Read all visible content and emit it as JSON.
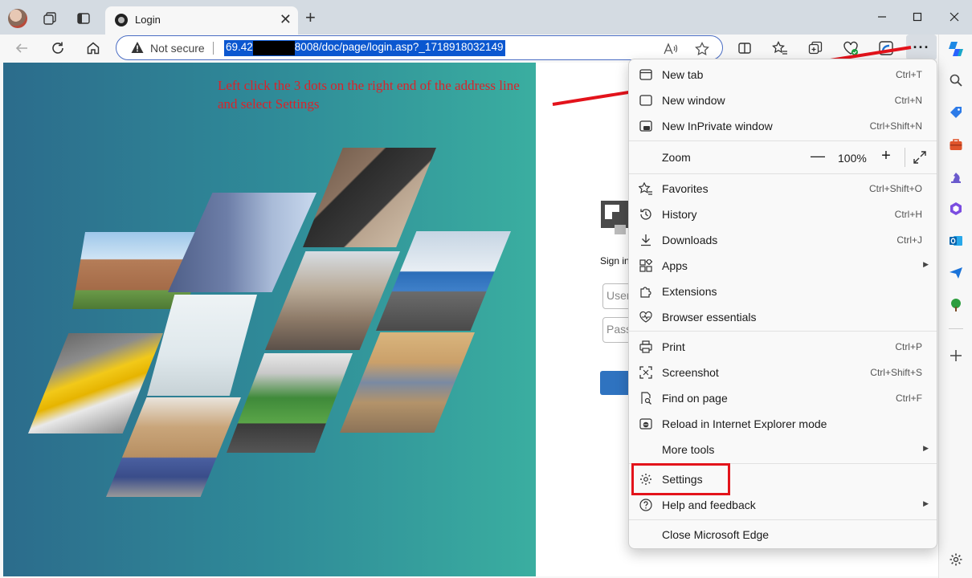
{
  "browser": {
    "tab_title": "Login",
    "close_glyph": "✕",
    "newtab_glyph": "+",
    "address": {
      "security_label": "Not secure",
      "url_prefix": "69.42",
      "url_suffix": "8008/doc/page/login.asp?_1718918032149"
    },
    "more_glyph": "···"
  },
  "page": {
    "instruction": "Left click the 3 dots on the right end of the address line and select Settings",
    "signin_text": "Sign in",
    "username_placeholder": "Username",
    "password_placeholder": "Password"
  },
  "menu": {
    "new_tab": {
      "label": "New tab",
      "shortcut": "Ctrl+T"
    },
    "new_window": {
      "label": "New window",
      "shortcut": "Ctrl+N"
    },
    "new_inprivate": {
      "label": "New InPrivate window",
      "shortcut": "Ctrl+Shift+N"
    },
    "zoom": {
      "label": "Zoom",
      "value": "100%",
      "minus": "—",
      "plus": "+"
    },
    "favorites": {
      "label": "Favorites",
      "shortcut": "Ctrl+Shift+O"
    },
    "history": {
      "label": "History",
      "shortcut": "Ctrl+H"
    },
    "downloads": {
      "label": "Downloads",
      "shortcut": "Ctrl+J"
    },
    "apps": {
      "label": "Apps"
    },
    "extensions": {
      "label": "Extensions"
    },
    "browser_essentials": {
      "label": "Browser essentials"
    },
    "print": {
      "label": "Print",
      "shortcut": "Ctrl+P"
    },
    "screenshot": {
      "label": "Screenshot",
      "shortcut": "Ctrl+Shift+S"
    },
    "find_on_page": {
      "label": "Find on page",
      "shortcut": "Ctrl+F"
    },
    "reload_ie": {
      "label": "Reload in Internet Explorer mode"
    },
    "more_tools": {
      "label": "More tools"
    },
    "settings": {
      "label": "Settings"
    },
    "help": {
      "label": "Help and feedback"
    },
    "close_edge": {
      "label": "Close Microsoft Edge"
    },
    "submenu_arrow": "▶"
  },
  "colors": {
    "annotation": "#e3131b",
    "url_highlight": "#0b57d0",
    "hero_start": "#2c6c8c",
    "hero_end": "#3aaea0"
  },
  "icons": [
    "profile-avatar",
    "workspaces-icon",
    "tab-actions-icon",
    "back-icon",
    "refresh-icon",
    "home-icon",
    "warning-icon",
    "read-aloud-icon",
    "favorite-star-icon",
    "split-screen-icon",
    "favorites-icon",
    "collections-icon",
    "performance-icon",
    "extension-icon",
    "more-icon",
    "copilot-icon",
    "search-icon",
    "tag-icon",
    "toolbox-icon",
    "chess-icon",
    "office-icon",
    "outlook-icon",
    "send-icon",
    "tree-icon",
    "add-icon",
    "settings-icon"
  ]
}
